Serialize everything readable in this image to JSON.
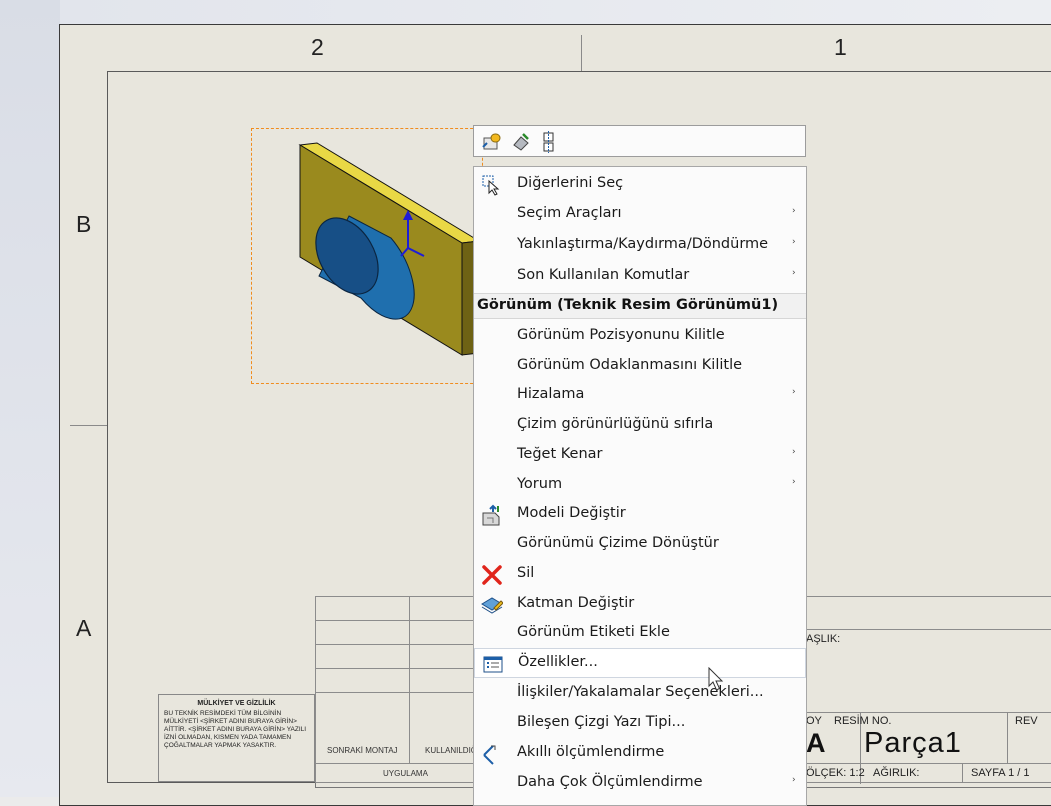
{
  "drawing": {
    "zones_top": [
      "2",
      "1"
    ],
    "zones_side": [
      "B",
      "A"
    ]
  },
  "title_block": {
    "owner_title": "MÜLKİYET VE GİZLİLİK",
    "owner_text": "BU TEKNİK RESİMDEKİ TÜM BİLGİNİN MÜLKİYETİ <ŞİRKET ADINI BURAYA GİRİN> AİTTİR. <ŞİRKET ADINI BURAYA GİRİN> YAZILI İZNİ OLMADAN, KISMEN YADA TAMAMEN ÇOĞALTMALAR YAPMAK YASAKTIR.",
    "next_assembly": "SONRAKİ MONTAJ",
    "used_on": "KULLANILDIĞ",
    "application": "UYGULAMA",
    "title_label": "AŞLIK:",
    "size_label": "OY",
    "dwg_no_label": "RESİM  NO.",
    "rev_label": "REV",
    "size_value": "A",
    "part_name": "Parça1",
    "scale": "ÖLÇEK: 1:2",
    "weight": "AĞIRLIK:",
    "sheet": "SAYFA 1 / 1"
  },
  "toolbar": {
    "icons": [
      "smart-dimension-view-icon",
      "model-items-icon",
      "align-view-icon"
    ]
  },
  "menu": {
    "items_top": [
      {
        "label": "Diğerlerini Seç",
        "submenu": false,
        "icon": "select-other-icon"
      },
      {
        "label": "Seçim Araçları",
        "submenu": true
      },
      {
        "label": "Yakınlaştırma/Kaydırma/Döndürme",
        "submenu": true
      },
      {
        "label": "Son Kullanılan Komutlar",
        "submenu": true
      }
    ],
    "section_header": "Görünüm (Teknik Resim Görünümü1)",
    "items_view": [
      {
        "label": "Görünüm Pozisyonunu Kilitle",
        "submenu": false
      },
      {
        "label": "Görünüm Odaklanmasını Kilitle",
        "submenu": false
      },
      {
        "label": "Hizalama",
        "submenu": true
      },
      {
        "label": "Çizim görünürlüğünü sıfırla",
        "submenu": false
      },
      {
        "label": "Teğet Kenar",
        "submenu": true
      },
      {
        "label": "Yorum",
        "submenu": true
      },
      {
        "label": "Modeli Değiştir",
        "submenu": false,
        "icon": "replace-model-icon"
      },
      {
        "label": "Görünümü Çizime Dönüştür",
        "submenu": false
      },
      {
        "label": "Sil",
        "submenu": false,
        "icon": "delete-icon"
      },
      {
        "label": "Katman Değiştir",
        "submenu": false,
        "icon": "layer-icon"
      },
      {
        "label": "Görünüm Etiketi Ekle",
        "submenu": false
      },
      {
        "label": "Özellikler...",
        "submenu": false,
        "icon": "properties-icon",
        "hovered": true
      },
      {
        "label": "İlişkiler/Yakalamalar Seçenekleri...",
        "submenu": false
      },
      {
        "label": "Bileşen Çizgi Yazı Tipi...",
        "submenu": false
      },
      {
        "label": "Akıllı ölçümlendirme",
        "submenu": false,
        "icon": "smart-dimension-icon"
      },
      {
        "label": "Daha Çok Ölçümlendirme",
        "submenu": true
      }
    ]
  },
  "colors": {
    "plate": "#9a8a1e",
    "cylinder": "#1f6fae",
    "selection_box": "#f08c1e",
    "delete_red": "#e0251b"
  }
}
